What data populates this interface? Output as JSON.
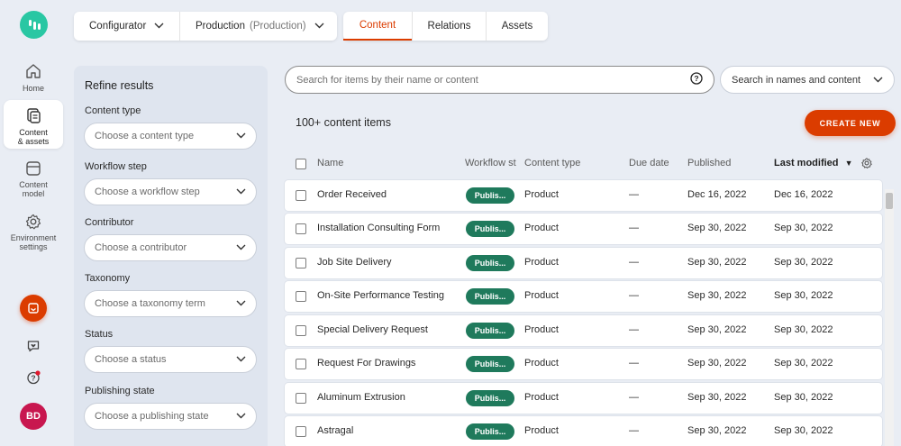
{
  "rail": {
    "items": [
      {
        "label1": "Home",
        "label2": "",
        "icon": "home-icon"
      },
      {
        "label1": "Content",
        "label2": "& assets",
        "icon": "content-icon"
      },
      {
        "label1": "Content",
        "label2": "model",
        "icon": "content-model-icon"
      },
      {
        "label1": "Environment",
        "label2": "settings",
        "icon": "gear-icon"
      }
    ],
    "avatar_initials": "BD",
    "colors": {
      "logo": "#29c7a3",
      "accent": "#db3c00",
      "avatar": "#c8174f"
    }
  },
  "topbar": {
    "project": "Configurator",
    "environment": "Production",
    "environment_note": "(Production)",
    "tabs": [
      "Content",
      "Relations",
      "Assets"
    ],
    "active_tab": "Content"
  },
  "filters": {
    "title": "Refine results",
    "groups": [
      {
        "label": "Content type",
        "placeholder": "Choose a content type"
      },
      {
        "label": "Workflow step",
        "placeholder": "Choose a workflow step"
      },
      {
        "label": "Contributor",
        "placeholder": "Choose a contributor"
      },
      {
        "label": "Taxonomy",
        "placeholder": "Choose a taxonomy term"
      },
      {
        "label": "Status",
        "placeholder": "Choose a status"
      },
      {
        "label": "Publishing state",
        "placeholder": "Choose a publishing state"
      }
    ]
  },
  "search": {
    "placeholder": "Search for items by their name or content",
    "mode": "Search in names and content"
  },
  "list": {
    "count": "100+ content items",
    "create_label": "CREATE NEW",
    "columns": [
      "Name",
      "Workflow st",
      "Content type",
      "Due date",
      "Published",
      "Last modified"
    ],
    "rows": [
      {
        "name": "Order Received",
        "workflow": "Publis...",
        "type": "Product",
        "due": "—",
        "published": "Dec 16, 2022",
        "modified": "Dec 16, 2022"
      },
      {
        "name": "Installation Consulting Form",
        "workflow": "Publis...",
        "type": "Product",
        "due": "—",
        "published": "Sep 30, 2022",
        "modified": "Sep 30, 2022"
      },
      {
        "name": "Job Site Delivery",
        "workflow": "Publis...",
        "type": "Product",
        "due": "—",
        "published": "Sep 30, 2022",
        "modified": "Sep 30, 2022"
      },
      {
        "name": "On-Site Performance Testing",
        "workflow": "Publis...",
        "type": "Product",
        "due": "—",
        "published": "Sep 30, 2022",
        "modified": "Sep 30, 2022"
      },
      {
        "name": "Special Delivery Request",
        "workflow": "Publis...",
        "type": "Product",
        "due": "—",
        "published": "Sep 30, 2022",
        "modified": "Sep 30, 2022"
      },
      {
        "name": "Request For Drawings",
        "workflow": "Publis...",
        "type": "Product",
        "due": "—",
        "published": "Sep 30, 2022",
        "modified": "Sep 30, 2022"
      },
      {
        "name": "Aluminum Extrusion",
        "workflow": "Publis...",
        "type": "Product",
        "due": "—",
        "published": "Sep 30, 2022",
        "modified": "Sep 30, 2022"
      },
      {
        "name": "Astragal",
        "workflow": "Publis...",
        "type": "Product",
        "due": "—",
        "published": "Sep 30, 2022",
        "modified": "Sep 30, 2022"
      }
    ],
    "workflow_badge_color": "#1f7a5c"
  }
}
